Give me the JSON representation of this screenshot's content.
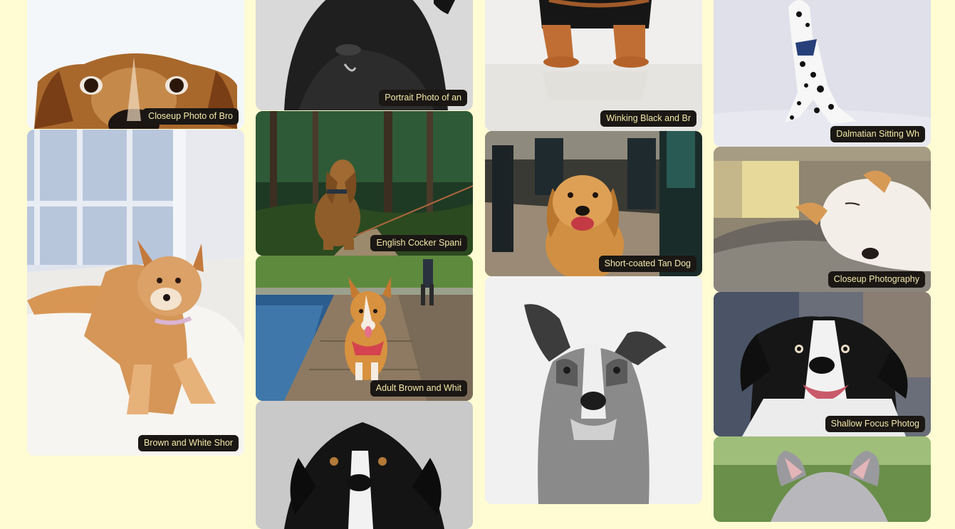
{
  "gallery": {
    "cards": [
      {
        "caption": "Closeup Photo of Bro",
        "subject": "brown-dog-closeup-photo"
      },
      {
        "caption": "Brown and White Shor",
        "subject": "shiba-puppy-on-rug-photo"
      },
      {
        "caption": "Portrait Photo of an",
        "subject": "black-dog-portrait-photo"
      },
      {
        "caption": "English Cocker Spani",
        "subject": "cocker-spaniel-forest-photo"
      },
      {
        "caption": "Adult Brown and Whit",
        "subject": "corgi-on-boardwalk-photo"
      },
      {
        "caption": "",
        "subject": "black-white-dog-photo"
      },
      {
        "caption": "Winking Black and Br",
        "subject": "black-brown-puppy-photo"
      },
      {
        "caption": "Short-coated Tan Dog",
        "subject": "golden-retriever-photo"
      },
      {
        "caption": "",
        "subject": "grayscale-pitbull-photo"
      },
      {
        "caption": "Dalmatian Sitting Wh",
        "subject": "dalmatian-sitting-photo"
      },
      {
        "caption": "Closeup Photography",
        "subject": "sleeping-dog-photo"
      },
      {
        "caption": "Shallow Focus Photog",
        "subject": "border-collie-photo"
      },
      {
        "caption": "",
        "subject": "gray-dog-ears-photo"
      }
    ]
  },
  "colors": {
    "page_background": "#fffbd3",
    "caption_background": "#1a1714",
    "caption_text": "#f5e9a8"
  }
}
